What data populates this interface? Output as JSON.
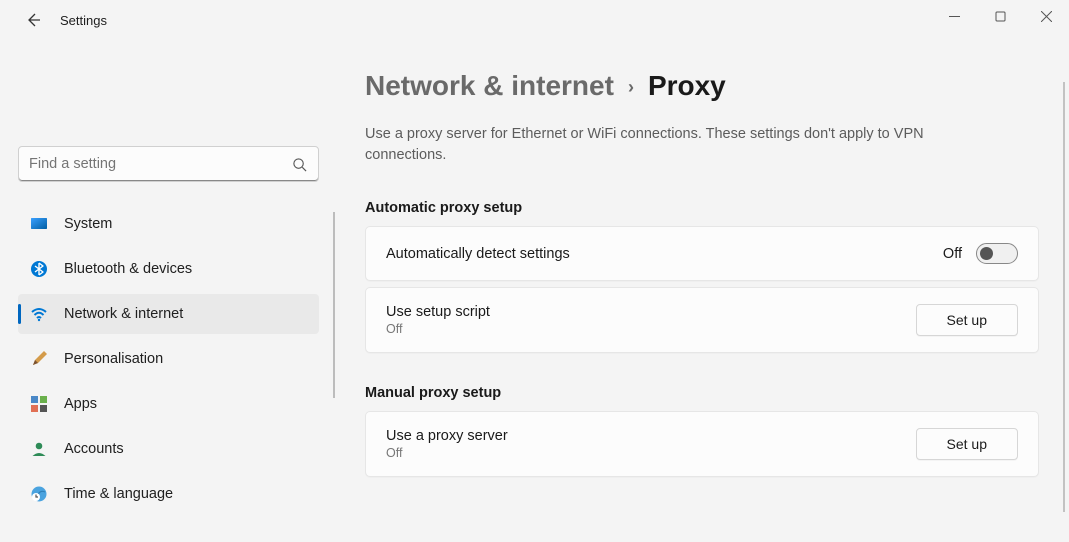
{
  "app_title": "Settings",
  "search": {
    "placeholder": "Find a setting"
  },
  "sidebar": {
    "items": [
      {
        "label": "System"
      },
      {
        "label": "Bluetooth & devices"
      },
      {
        "label": "Network & internet"
      },
      {
        "label": "Personalisation"
      },
      {
        "label": "Apps"
      },
      {
        "label": "Accounts"
      },
      {
        "label": "Time & language"
      }
    ]
  },
  "breadcrumb": {
    "parent": "Network & internet",
    "current": "Proxy"
  },
  "description": "Use a proxy server for Ethernet or WiFi connections. These settings don't apply to VPN connections.",
  "auto": {
    "section_title": "Automatic proxy setup",
    "detect": {
      "label": "Automatically detect settings",
      "status": "Off"
    },
    "script": {
      "label": "Use setup script",
      "status": "Off",
      "button": "Set up"
    }
  },
  "manual": {
    "section_title": "Manual proxy setup",
    "proxy": {
      "label": "Use a proxy server",
      "status": "Off",
      "button": "Set up"
    }
  }
}
